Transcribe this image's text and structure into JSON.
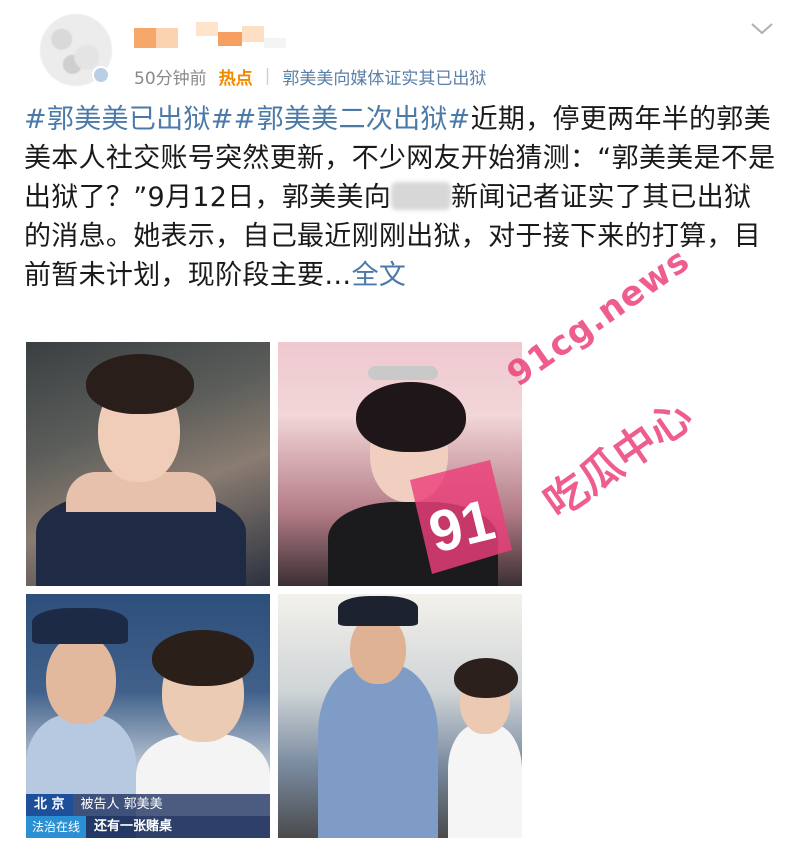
{
  "post": {
    "time": "50分钟前",
    "hot_label": "热点",
    "separator": "|",
    "topic": "郭美美向媒体证实其已出狱",
    "hashtag1": "#郭美美已出狱#",
    "hashtag2": "#郭美美二次出狱#",
    "text_part1": "近期，停更两年半的郭美美本人社交账号突然更新，不少网友开始猜测：“郭美美是不是出狱了？”9月12日，郭美美向",
    "text_part2": "新闻记者证实了其已出狱的消息。她表示，自己最近刚刚出狱，对于接下来的打算，目前暂未计划，现阶段主要…",
    "fulltext_link": "全文"
  },
  "photo3_overlay": {
    "city": "北  京",
    "caption": "被告人 郭美美",
    "logo": "法治在线",
    "subtitle": "还有一张赌桌"
  },
  "watermark": {
    "badge": "91",
    "url": "91cg.news",
    "name": "吃瓜中心"
  },
  "colors": {
    "hashtag": "#4c7aa8",
    "hot": "#f08a00",
    "watermark": "#ec407a"
  }
}
